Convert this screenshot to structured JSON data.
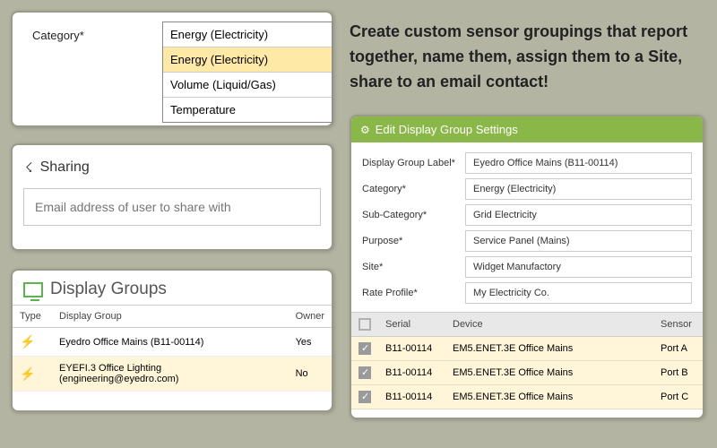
{
  "caption": "Create custom sensor groupings that report together, name them, assign them to a Site, share to an email contact!",
  "category_panel": {
    "label": "Category*",
    "options": [
      "Energy (Electricity)",
      "Energy (Electricity)",
      "Volume (Liquid/Gas)",
      "Temperature"
    ],
    "selected_index": 1
  },
  "sharing_panel": {
    "title": "Sharing",
    "placeholder": "Email address of user to share with"
  },
  "display_groups_panel": {
    "title": "Display Groups",
    "columns": [
      "Type",
      "Display Group",
      "Owner"
    ],
    "rows": [
      {
        "group": "Eyedro Office Mains (B11-00114)",
        "owner": "Yes"
      },
      {
        "group": "EYEFI.3 Office Lighting (engineering@eyedro.com)",
        "owner": "No"
      }
    ]
  },
  "edit_panel": {
    "header": "Edit Display Group Settings",
    "fields": [
      {
        "label": "Display Group Label*",
        "value": "Eyedro Office Mains (B11-00114)"
      },
      {
        "label": "Category*",
        "value": "Energy (Electricity)"
      },
      {
        "label": "Sub-Category*",
        "value": "Grid Electricity"
      },
      {
        "label": "Purpose*",
        "value": "Service Panel (Mains)"
      },
      {
        "label": "Site*",
        "value": "Widget Manufactory"
      },
      {
        "label": "Rate Profile*",
        "value": "My Electricity Co."
      }
    ],
    "table": {
      "columns": [
        "",
        "Serial",
        "Device",
        "Sensor"
      ],
      "rows": [
        {
          "checked": true,
          "serial": "B11-00114",
          "device": "EM5.ENET.3E Office Mains",
          "sensor": "Port A"
        },
        {
          "checked": true,
          "serial": "B11-00114",
          "device": "EM5.ENET.3E Office Mains",
          "sensor": "Port B"
        },
        {
          "checked": true,
          "serial": "B11-00114",
          "device": "EM5.ENET.3E Office Mains",
          "sensor": "Port C"
        }
      ]
    }
  }
}
